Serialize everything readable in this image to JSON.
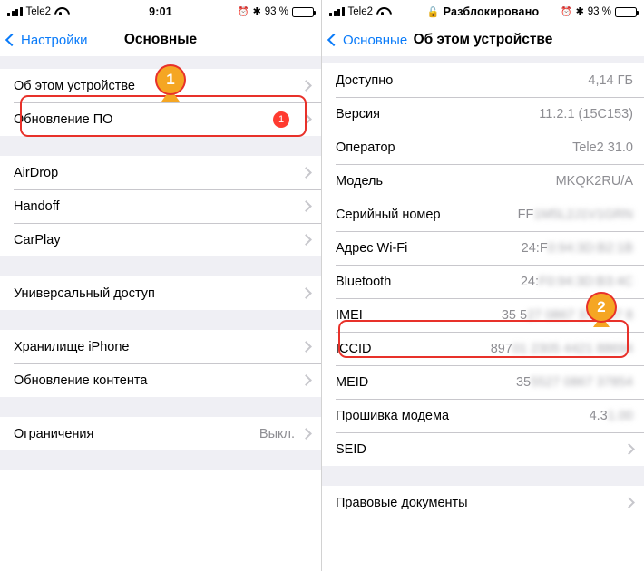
{
  "left": {
    "statusbar": {
      "carrier": "Tele2",
      "time": "9:01",
      "battery_pct": "93 %",
      "icons": [
        "signal-icon",
        "wifi-icon",
        "alarm-icon",
        "bluetooth-icon",
        "battery-icon"
      ]
    },
    "nav": {
      "back": "Настройки",
      "title": "Основные"
    },
    "groups": [
      {
        "rows": [
          {
            "label": "Об этом устройстве",
            "value": "",
            "chevron": true
          },
          {
            "label": "Обновление ПО",
            "value": "",
            "badge": "1",
            "chevron": true
          }
        ]
      },
      {
        "rows": [
          {
            "label": "AirDrop",
            "value": "",
            "chevron": true
          },
          {
            "label": "Handoff",
            "value": "",
            "chevron": true
          },
          {
            "label": "CarPlay",
            "value": "",
            "chevron": true
          }
        ]
      },
      {
        "rows": [
          {
            "label": "Универсальный доступ",
            "value": "",
            "chevron": true
          }
        ]
      },
      {
        "rows": [
          {
            "label": "Хранилище iPhone",
            "value": "",
            "chevron": true
          },
          {
            "label": "Обновление контента",
            "value": "",
            "chevron": true
          }
        ]
      },
      {
        "rows": [
          {
            "label": "Ограничения",
            "value": "Выкл.",
            "chevron": true
          }
        ]
      }
    ],
    "callout": {
      "number": "1"
    }
  },
  "right": {
    "statusbar": {
      "carrier": "Tele2",
      "center_text": "Разблокировано",
      "battery_pct": "93 %",
      "icons": [
        "signal-icon",
        "wifi-icon",
        "lock-open-icon",
        "alarm-icon",
        "bluetooth-icon",
        "battery-icon"
      ]
    },
    "nav": {
      "back": "Основные",
      "title": "Об этом устройстве"
    },
    "rows": [
      {
        "label": "Доступно",
        "value": "4,14 ГБ",
        "blur": false,
        "chevron": false
      },
      {
        "label": "Версия",
        "value": "11.2.1 (15C153)",
        "blur": false,
        "chevron": false
      },
      {
        "label": "Оператор",
        "value": "Tele2 31.0",
        "blur": false,
        "chevron": false
      },
      {
        "label": "Модель",
        "value": "MKQK2RU/A",
        "blur": false,
        "chevron": false
      },
      {
        "label": "Серийный номер",
        "value_clear": "FF",
        "value_blur": "1M5L2J1V1GRN",
        "blur": true,
        "chevron": false
      },
      {
        "label": "Адрес Wi-Fi",
        "value_clear": "24:F",
        "value_blur": "0:94:3D:B2:1B",
        "blur": true,
        "chevron": false
      },
      {
        "label": "Bluetooth",
        "value_clear": "24:",
        "value_blur": "F0:94:3D:B3:4C",
        "blur": true,
        "chevron": false
      },
      {
        "label": "IMEI",
        "value_clear": "35 5",
        "value_blur": "27 0867 378547 8",
        "blur": true,
        "chevron": false
      },
      {
        "label": "ICCID",
        "value_clear": "897",
        "value_blur": "01 2305 4421 88694",
        "blur": true,
        "chevron": false
      },
      {
        "label": "MEID",
        "value_clear": "35",
        "value_blur": "5527 0867 37854",
        "blur": true,
        "chevron": false
      },
      {
        "label": "Прошивка модема",
        "value_clear": "4.3",
        "value_blur": "1.00",
        "blur": true,
        "chevron": false
      },
      {
        "label": "SEID",
        "value": "",
        "blur": false,
        "chevron": true
      }
    ],
    "footer_rows": [
      {
        "label": "Правовые документы",
        "value": "",
        "chevron": true
      }
    ],
    "callout": {
      "number": "2"
    }
  }
}
